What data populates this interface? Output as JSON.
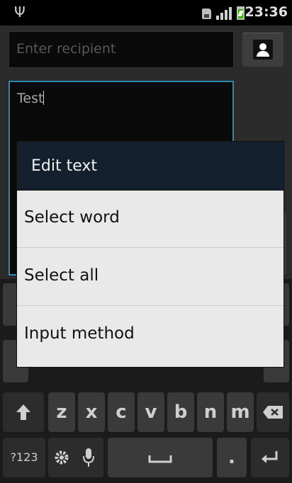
{
  "status_bar": {
    "time": "23:36",
    "icons": [
      "usb-icon",
      "sim-icon",
      "signal-icon",
      "battery-charging-icon"
    ]
  },
  "compose": {
    "recipient_placeholder": "Enter recipient",
    "message_text": "Test"
  },
  "dialog": {
    "title": "Edit text",
    "items": [
      {
        "label": "Select word"
      },
      {
        "label": "Select all"
      },
      {
        "label": "Input method"
      }
    ]
  },
  "keyboard": {
    "row3": [
      "z",
      "x",
      "c",
      "v",
      "b",
      "n",
      "m"
    ],
    "symbols_label": "?123",
    "icons": [
      "shift-icon",
      "backspace-icon",
      "settings-icon",
      "mic-icon",
      "space-icon",
      "enter-icon"
    ],
    "period_label": "."
  },
  "colors": {
    "focus_border": "#2f88b4",
    "dialog_header": "#15202e",
    "dialog_body": "#e9e9e9",
    "battery": "#3ab300"
  }
}
